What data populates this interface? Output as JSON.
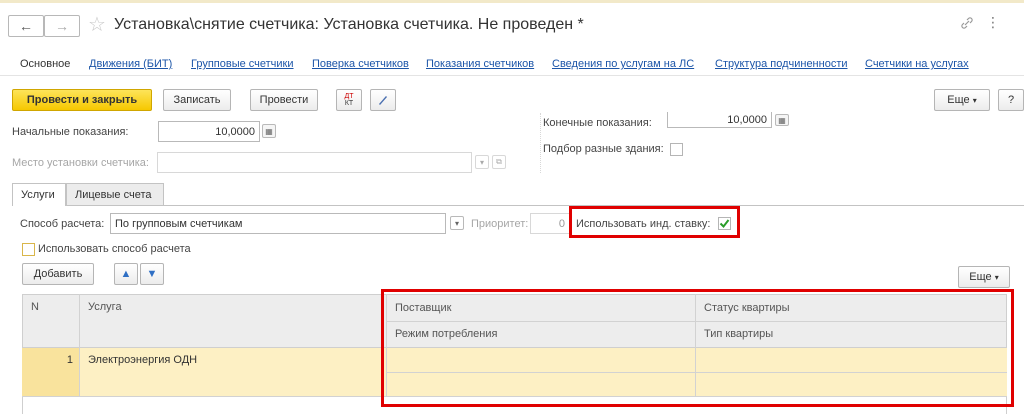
{
  "window": {
    "title": "Установка\\снятие счетчика: Установка счетчика. Не проведен *",
    "nav_back": "←",
    "nav_forward": "→",
    "star": "☆",
    "link_icon": "🔗",
    "more_icon": "⋮"
  },
  "tabs": {
    "items": [
      "Основное",
      "Движения (БИТ)",
      "Групповые счетчики",
      "Поверка счетчиков",
      "Показания счетчиков",
      "Сведения по услугам на ЛС",
      "Структура подчиненности",
      "Счетчики на услугах"
    ]
  },
  "toolbar": {
    "post_close": "Провести и закрыть",
    "save": "Записать",
    "post": "Провести",
    "dt_kt_top": "ДТ",
    "dt_kt_bottom": "КТ",
    "more": "Еще",
    "help": "?"
  },
  "form": {
    "initial_readings_label": "Начальные показания:",
    "initial_readings_value": "10,0000",
    "final_readings_label": "Конечные показания:",
    "final_readings_value": "10,0000",
    "install_place_label": "Место установки счетчика:",
    "install_place_value": "",
    "different_buildings_label": "Подбор разные здания:"
  },
  "section_tabs": {
    "services": "Услуги",
    "accounts": "Лицевые счета"
  },
  "services": {
    "calc_method_label": "Способ расчета:",
    "calc_method_value": "По групповым счетчикам",
    "priority_label": "Приоритет:",
    "priority_value": "0",
    "use_ind_rate_label": "Использовать инд. ставку:",
    "use_ind_rate_checked": true,
    "use_calc_method_label": "Использовать способ расчета",
    "add_button": "Добавить",
    "more_button": "Еще"
  },
  "table": {
    "headers": {
      "n": "N",
      "service": "Услуга",
      "supplier": "Поставщик",
      "apartment_status": "Статус квартиры",
      "consumption_mode": "Режим потребления",
      "apartment_type": "Тип квартиры"
    },
    "rows": [
      {
        "n": "1",
        "service": "Электроэнергия ОДН",
        "supplier": "",
        "apartment_status": "",
        "consumption_mode": "",
        "apartment_type": ""
      }
    ]
  },
  "colors": {
    "accent_yellow": "#f6c800",
    "link_blue": "#1c55a8",
    "highlight_red": "#e00000",
    "selected_row": "#fdf0c4"
  }
}
